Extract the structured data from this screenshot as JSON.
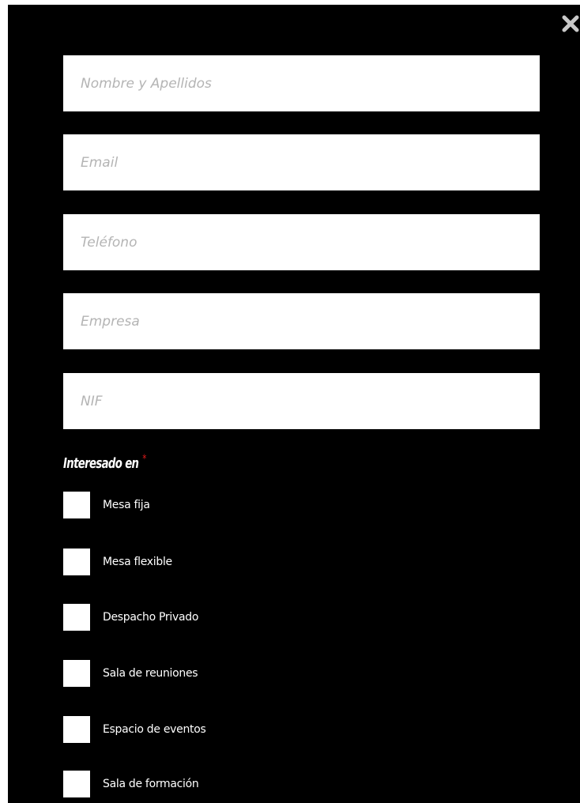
{
  "modal": {
    "close_icon": "close-icon",
    "fields": [
      {
        "name": "full-name-field",
        "placeholder": "Nombre y Apellidos"
      },
      {
        "name": "email-field",
        "placeholder": "Email"
      },
      {
        "name": "phone-field",
        "placeholder": "Teléfono"
      },
      {
        "name": "company-field",
        "placeholder": "Empresa"
      },
      {
        "name": "nif-field",
        "placeholder": "NIF"
      }
    ],
    "interest": {
      "label": "Interesado en",
      "required_mark": "*",
      "options": [
        {
          "label": "Mesa fija",
          "checked": false
        },
        {
          "label": "Mesa flexible",
          "checked": false
        },
        {
          "label": "Despacho Privado",
          "checked": false
        },
        {
          "label": "Sala de reuniones",
          "checked": false
        },
        {
          "label": "Espacio de eventos",
          "checked": false
        },
        {
          "label": "Sala de formación",
          "checked": false
        }
      ]
    }
  },
  "colors": {
    "background": "#000000",
    "field_background": "#ffffff",
    "placeholder": "#b4b4b4",
    "required": "#e01b1b",
    "close_icon": "#c8c8c8"
  }
}
